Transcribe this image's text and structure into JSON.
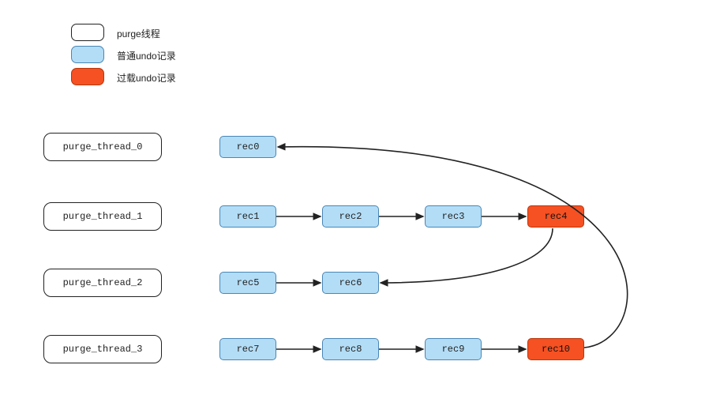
{
  "legend": {
    "thread": "purge线程",
    "normal": "普通undo记录",
    "overload": "过载undo记录"
  },
  "threads": {
    "t0": "purge_thread_0",
    "t1": "purge_thread_1",
    "t2": "purge_thread_2",
    "t3": "purge_thread_3"
  },
  "recs": {
    "r0": {
      "label": "rec0",
      "kind": "normal"
    },
    "r1": {
      "label": "rec1",
      "kind": "normal"
    },
    "r2": {
      "label": "rec2",
      "kind": "normal"
    },
    "r3": {
      "label": "rec3",
      "kind": "normal"
    },
    "r4": {
      "label": "rec4",
      "kind": "overload"
    },
    "r5": {
      "label": "rec5",
      "kind": "normal"
    },
    "r6": {
      "label": "rec6",
      "kind": "normal"
    },
    "r7": {
      "label": "rec7",
      "kind": "normal"
    },
    "r8": {
      "label": "rec8",
      "kind": "normal"
    },
    "r9": {
      "label": "rec9",
      "kind": "normal"
    },
    "r10": {
      "label": "rec10",
      "kind": "overload"
    }
  },
  "colors": {
    "normal_fill": "#b3ddf6",
    "normal_border": "#4a86b5",
    "overload_fill": "#f55123",
    "overload_border": "#b8360b",
    "thread_fill": "#ffffff",
    "arrow": "#222222"
  },
  "chart_data": {
    "type": "diagram",
    "title": "",
    "nodes": [
      {
        "id": "purge_thread_0",
        "kind": "thread",
        "label": "purge_thread_0"
      },
      {
        "id": "purge_thread_1",
        "kind": "thread",
        "label": "purge_thread_1"
      },
      {
        "id": "purge_thread_2",
        "kind": "thread",
        "label": "purge_thread_2"
      },
      {
        "id": "purge_thread_3",
        "kind": "thread",
        "label": "purge_thread_3"
      },
      {
        "id": "rec0",
        "kind": "normal",
        "owner": "purge_thread_0"
      },
      {
        "id": "rec1",
        "kind": "normal",
        "owner": "purge_thread_1"
      },
      {
        "id": "rec2",
        "kind": "normal",
        "owner": "purge_thread_1"
      },
      {
        "id": "rec3",
        "kind": "normal",
        "owner": "purge_thread_1"
      },
      {
        "id": "rec4",
        "kind": "overload",
        "owner": "purge_thread_1"
      },
      {
        "id": "rec5",
        "kind": "normal",
        "owner": "purge_thread_2"
      },
      {
        "id": "rec6",
        "kind": "normal",
        "owner": "purge_thread_2"
      },
      {
        "id": "rec7",
        "kind": "normal",
        "owner": "purge_thread_3"
      },
      {
        "id": "rec8",
        "kind": "normal",
        "owner": "purge_thread_3"
      },
      {
        "id": "rec9",
        "kind": "normal",
        "owner": "purge_thread_3"
      },
      {
        "id": "rec10",
        "kind": "overload",
        "owner": "purge_thread_3"
      }
    ],
    "edges": [
      {
        "from": "rec1",
        "to": "rec2"
      },
      {
        "from": "rec2",
        "to": "rec3"
      },
      {
        "from": "rec3",
        "to": "rec4"
      },
      {
        "from": "rec5",
        "to": "rec6"
      },
      {
        "from": "rec7",
        "to": "rec8"
      },
      {
        "from": "rec8",
        "to": "rec9"
      },
      {
        "from": "rec9",
        "to": "rec10"
      },
      {
        "from": "rec4",
        "to": "rec6",
        "note": "overload-reassign"
      },
      {
        "from": "rec10",
        "to": "rec0",
        "note": "overload-reassign"
      }
    ],
    "legend": [
      {
        "kind": "thread",
        "label": "purge线程"
      },
      {
        "kind": "normal",
        "label": "普通undo记录"
      },
      {
        "kind": "overload",
        "label": "过载undo记录"
      }
    ]
  }
}
